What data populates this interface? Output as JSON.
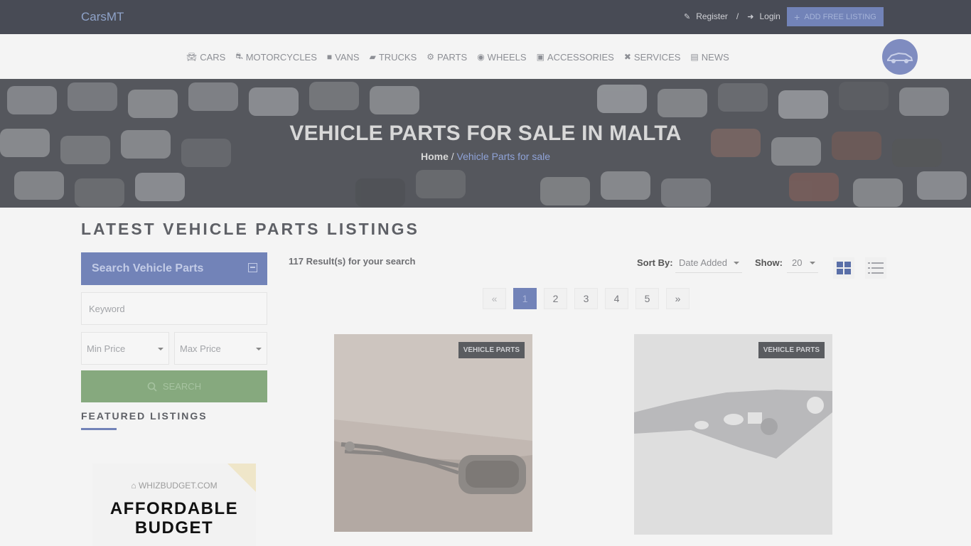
{
  "header": {
    "brand": "CarsMT",
    "register": "Register",
    "separator": "/",
    "login": "Login",
    "add_listing": "ADD FREE LISTING"
  },
  "nav": {
    "items": [
      {
        "label": "CARS",
        "icon": "car-icon"
      },
      {
        "label": "MOTORCYCLES",
        "icon": "motorcycle-icon"
      },
      {
        "label": "VANS",
        "icon": "van-icon"
      },
      {
        "label": "TRUCKS",
        "icon": "truck-icon"
      },
      {
        "label": "PARTS",
        "icon": "parts-icon"
      },
      {
        "label": "WHEELS",
        "icon": "wheel-icon"
      },
      {
        "label": "ACCESSORIES",
        "icon": "accessories-icon"
      },
      {
        "label": "SERVICES",
        "icon": "tools-icon"
      },
      {
        "label": "NEWS",
        "icon": "news-icon"
      }
    ]
  },
  "hero": {
    "title": "VEHICLE PARTS FOR SALE IN MALTA",
    "breadcrumb_home": "Home",
    "breadcrumb_sep": " / ",
    "breadcrumb_current": "Vehicle Parts for sale"
  },
  "section_title": "LATEST VEHICLE PARTS LISTINGS",
  "sidebar": {
    "search_title": "Search Vehicle Parts",
    "keyword_placeholder": "Keyword",
    "min_price": "Min Price",
    "max_price": "Max Price",
    "search_button": "SEARCH",
    "featured_title": "FEATURED LISTINGS",
    "ad": {
      "site": "WHIZBUDGET.COM",
      "line1": "AFFORDABLE",
      "line2": "BUDGET"
    }
  },
  "results": {
    "count_text": "117 Result(s) for your search",
    "sort_label": "Sort By:",
    "sort_value": "Date Added",
    "show_label": "Show:",
    "show_value": "20"
  },
  "pagination": {
    "prev": "«",
    "pages": [
      "1",
      "2",
      "3",
      "4",
      "5"
    ],
    "next": "»",
    "current": "1"
  },
  "listings": [
    {
      "badge": "VEHICLE PARTS",
      "image": "exhaust-muffler"
    },
    {
      "badge": "VEHICLE PARTS",
      "image": "control-arm"
    }
  ],
  "colors": {
    "accent": "#7283b8",
    "topbar": "#484b55",
    "search_button": "#86a97e"
  }
}
